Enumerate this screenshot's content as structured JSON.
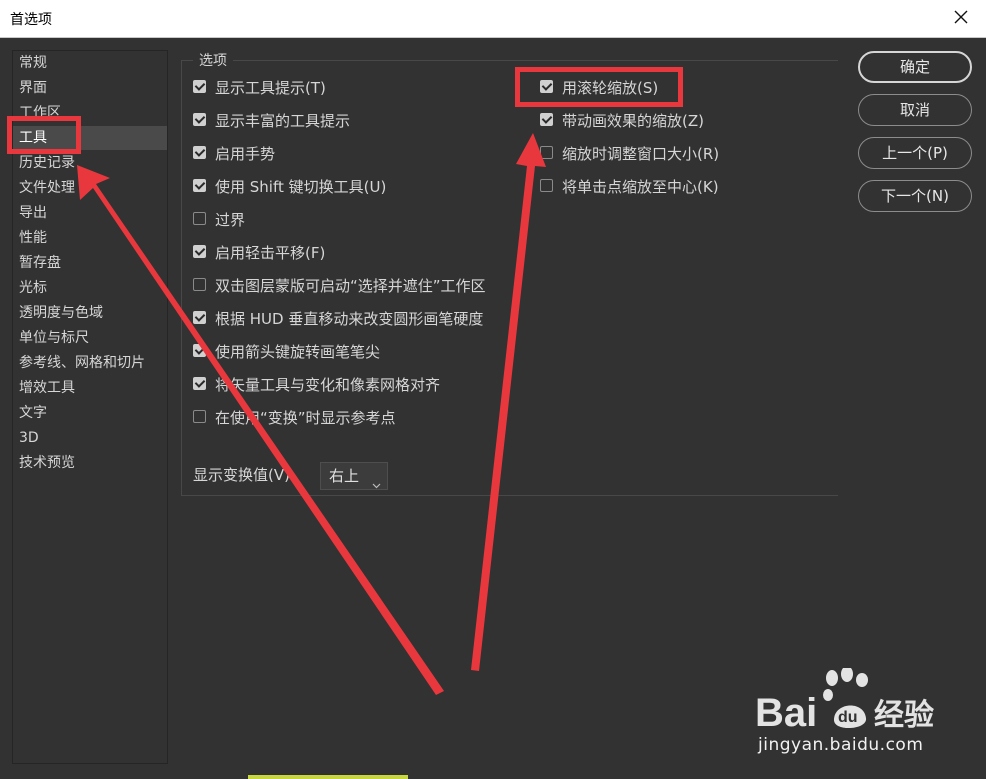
{
  "window": {
    "title": "首选项"
  },
  "sidebar": {
    "items": [
      {
        "label": "常规"
      },
      {
        "label": "界面"
      },
      {
        "label": "工作区"
      },
      {
        "label": "工具"
      },
      {
        "label": "历史记录"
      },
      {
        "label": "文件处理"
      },
      {
        "label": "导出"
      },
      {
        "label": "性能"
      },
      {
        "label": "暂存盘"
      },
      {
        "label": "光标"
      },
      {
        "label": "透明度与色域"
      },
      {
        "label": "单位与标尺"
      },
      {
        "label": "参考线、网格和切片"
      },
      {
        "label": "增效工具"
      },
      {
        "label": "文字"
      },
      {
        "label": "3D"
      },
      {
        "label": "技术预览"
      }
    ],
    "active": "工具"
  },
  "options": {
    "legend": "选项",
    "left": [
      {
        "label": "显示工具提示(T)",
        "checked": true
      },
      {
        "label": "显示丰富的工具提示",
        "checked": true
      },
      {
        "label": "启用手势",
        "checked": true
      },
      {
        "label": "使用 Shift 键切换工具(U)",
        "checked": true
      },
      {
        "label": "过界",
        "checked": false
      },
      {
        "label": "启用轻击平移(F)",
        "checked": true
      },
      {
        "label": "双击图层蒙版可启动“选择并遮住”工作区",
        "checked": false
      },
      {
        "label": "根据 HUD 垂直移动来改变圆形画笔硬度",
        "checked": true
      },
      {
        "label": "使用箭头键旋转画笔笔尖",
        "checked": true
      },
      {
        "label": "将矢量工具与变化和像素网格对齐",
        "checked": true
      },
      {
        "label": "在使用“变换”时显示参考点",
        "checked": false
      }
    ],
    "right": [
      {
        "label": "用滚轮缩放(S)",
        "checked": true
      },
      {
        "label": "带动画效果的缩放(Z)",
        "checked": true
      },
      {
        "label": "缩放时调整窗口大小(R)",
        "checked": false
      },
      {
        "label": "将单击点缩放至中心(K)",
        "checked": false
      }
    ],
    "transform_label": "显示变换值(V):",
    "transform_value": "右上"
  },
  "buttons": {
    "ok": "确定",
    "cancel": "取消",
    "prev": "上一个(P)",
    "next": "下一个(N)"
  },
  "watermark": {
    "brand": "Bai",
    "brand2": "经验",
    "url": "jingyan.baidu.com"
  },
  "colors": {
    "background": "#323232",
    "highlight": "#e8383d",
    "text": "#d6d6d6"
  }
}
